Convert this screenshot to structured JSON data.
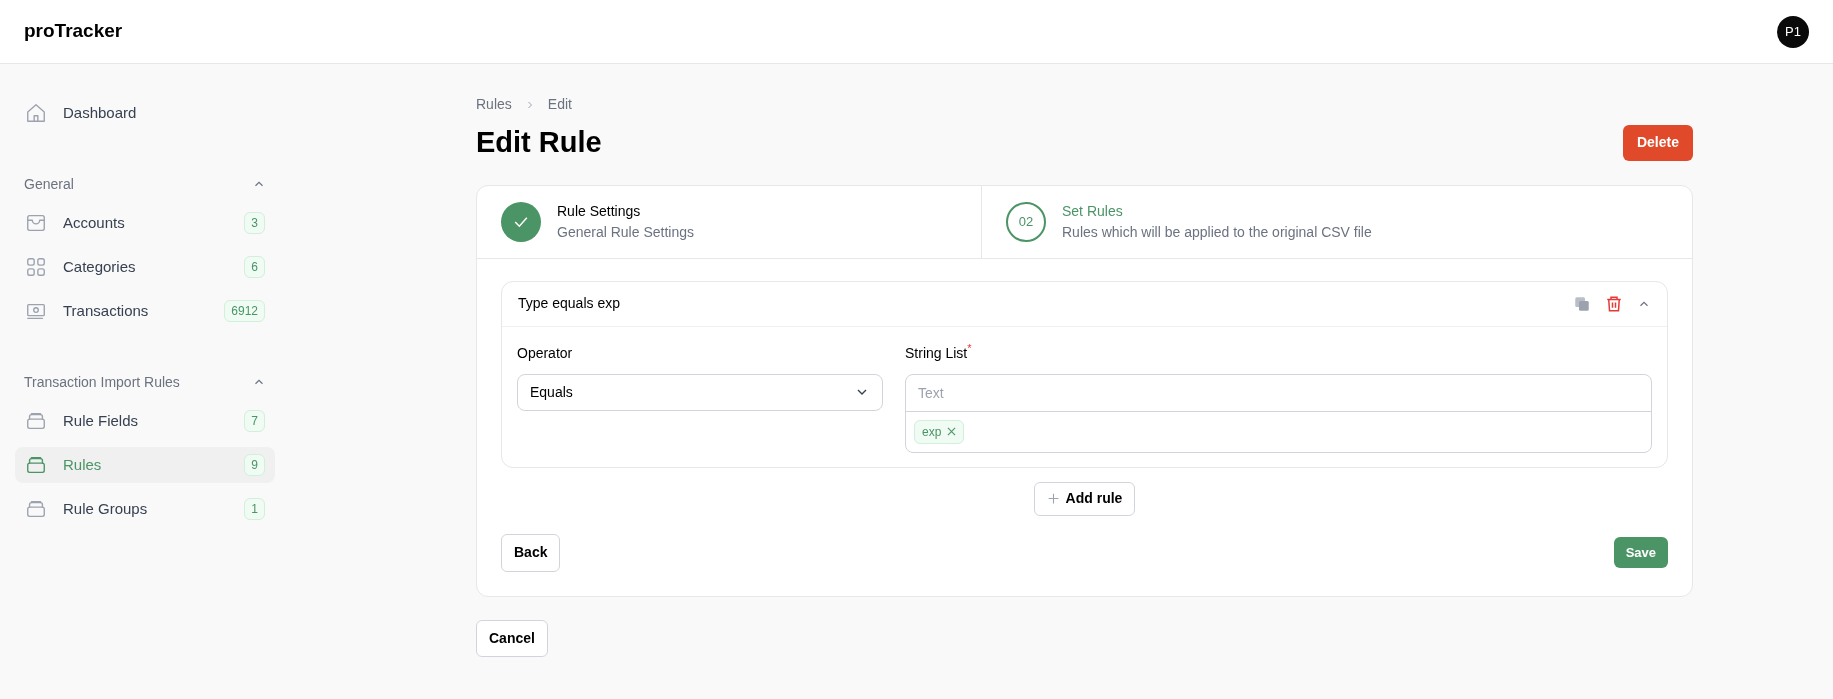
{
  "app": {
    "brand": "proTracker",
    "avatar": "P1"
  },
  "sidebar": {
    "top": [
      {
        "label": "Dashboard",
        "kind": "home",
        "selected": false
      }
    ],
    "sections": [
      {
        "title": "General",
        "expanded": true,
        "items": [
          {
            "label": "Accounts",
            "kind": "inbox",
            "badge": "3",
            "selected": false
          },
          {
            "label": "Categories",
            "kind": "grid",
            "badge": "6",
            "selected": false
          },
          {
            "label": "Transactions",
            "kind": "cash",
            "badge": "6912",
            "selected": false
          }
        ]
      },
      {
        "title": "Transaction Import Rules",
        "expanded": true,
        "items": [
          {
            "label": "Rule Fields",
            "kind": "stack",
            "badge": "7",
            "selected": false
          },
          {
            "label": "Rules",
            "kind": "stack",
            "badge": "9",
            "selected": true
          },
          {
            "label": "Rule Groups",
            "kind": "stack",
            "badge": "1",
            "selected": false
          }
        ]
      }
    ]
  },
  "breadcrumb": [
    "Rules",
    "Edit"
  ],
  "title": "Edit Rule",
  "delete_button": "Delete",
  "steps": [
    {
      "title": "Rule Settings",
      "subtitle": "General Rule Settings",
      "completed": true,
      "selected": false
    },
    {
      "number": "02",
      "title": "Set Rules",
      "subtitle": "Rules which will be applied to the original CSV file",
      "completed": false,
      "selected": true
    }
  ],
  "rules": [
    {
      "title": "Type equals exp",
      "expanded": true,
      "operator_label": "Operator",
      "operator_value": "Equals",
      "list_label": "String List",
      "required_mark": "*",
      "list_placeholder": "Text",
      "tags": [
        "exp"
      ]
    }
  ],
  "add_rule": "Add rule",
  "back_button": "Back",
  "save_button": "Save",
  "cancel_button": "Cancel"
}
